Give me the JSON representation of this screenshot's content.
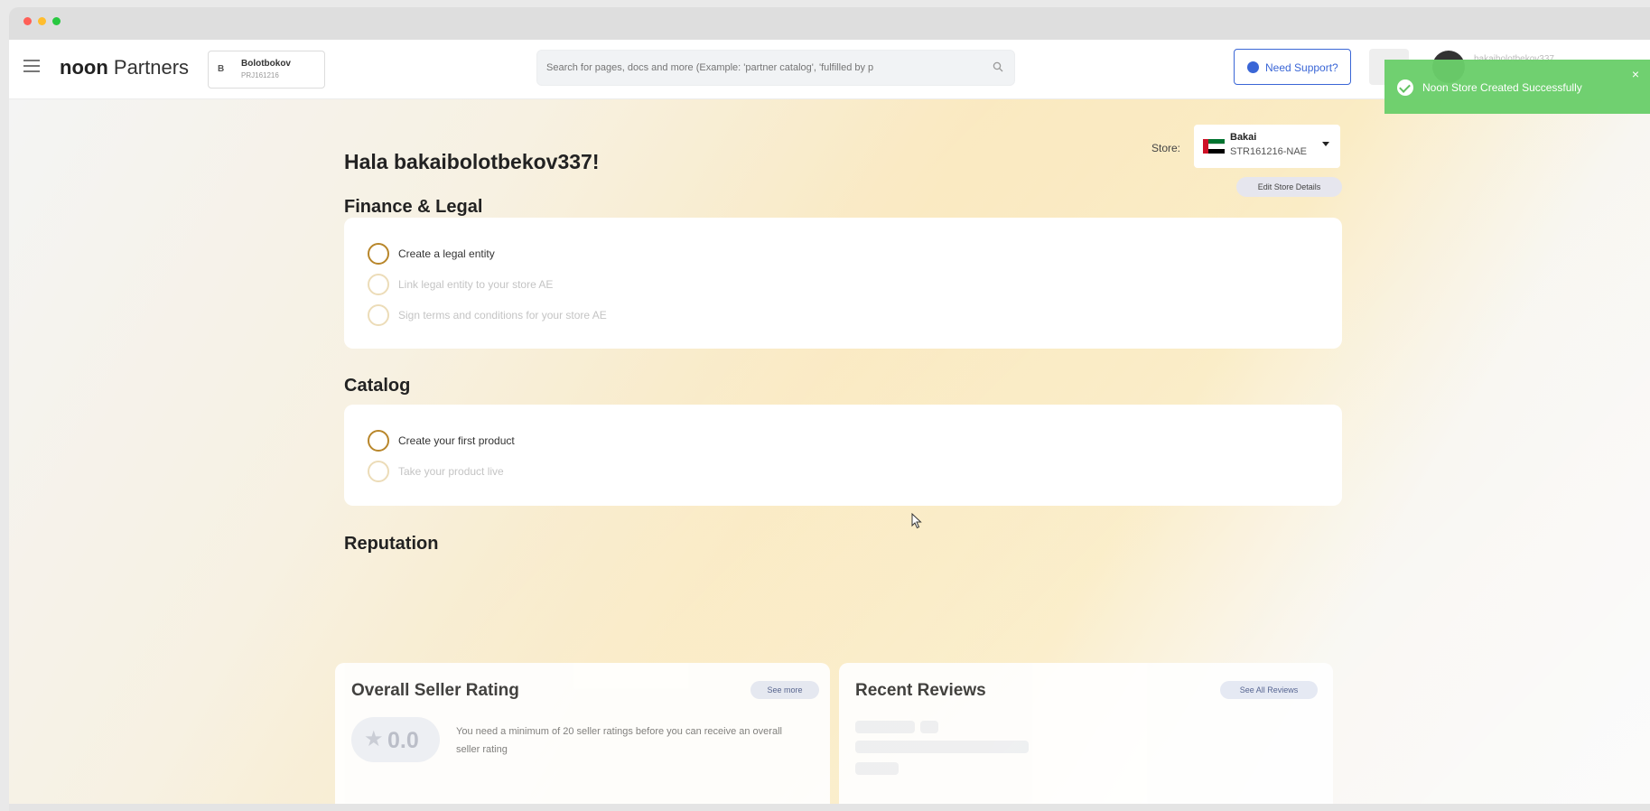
{
  "header": {
    "brand_bold": "noon",
    "brand_light": "Partners",
    "partner": {
      "initial": "B",
      "name": "Bolotbokov",
      "id": "PRJ161216"
    },
    "search": {
      "placeholder": "Search for pages, docs and more (Example: 'partner catalog', 'fulfilled by p"
    },
    "support_label": "Need Support?",
    "user_name": "bakaibolotbekov337"
  },
  "toast": {
    "message": "Noon Store Created Successfully",
    "close": "×"
  },
  "greeting": "Hala bakaibolotbekov337!",
  "store": {
    "label": "Store:",
    "name": "Bakai",
    "code": "STR161216-NAE",
    "edit_label": "Edit Store Details"
  },
  "finance": {
    "title": "Finance & Legal",
    "tasks": [
      {
        "label": "Create a legal entity"
      },
      {
        "label": "Link legal entity to your store AE"
      },
      {
        "label": "Sign terms and conditions for your store AE"
      }
    ]
  },
  "catalog": {
    "title": "Catalog",
    "tasks": [
      {
        "label": "Create your first product"
      },
      {
        "label": "Take your product live"
      }
    ]
  },
  "reputation": {
    "title": "Reputation",
    "rating": {
      "title": "Overall Seller Rating",
      "see_more": "See more",
      "value": "0.0",
      "note": "You need a minimum of 20 seller ratings before you can receive an overall seller rating"
    },
    "reviews": {
      "title": "Recent Reviews",
      "see_all": "See All Reviews"
    }
  },
  "colors": {
    "accent_blue": "#3a66d6",
    "task_circle": "#b8862a",
    "toast_green": "#6bcf6b"
  }
}
